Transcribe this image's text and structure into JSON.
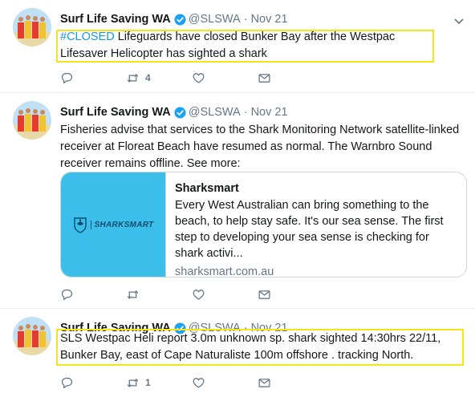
{
  "tweets": [
    {
      "account_name": "Surf Life Saving WA",
      "handle": "@SLSWA",
      "separator": "·",
      "date": "Nov 21",
      "hashtag": "#CLOSED",
      "text": " Lifeguards have closed Bunker Bay after the Westpac Lifesaver Helicopter has sighted a shark",
      "retweet_count": "4",
      "like_count": "",
      "reply_count": ""
    },
    {
      "account_name": "Surf Life Saving WA",
      "handle": "@SLSWA",
      "separator": "·",
      "date": "Nov 21",
      "text": "Fisheries advise that services to the Shark Monitoring Network satellite-linked receiver at Floreat Beach have resumed as normal. The Warnbro Sound receiver remains offline. See more:",
      "retweet_count": "",
      "like_count": "",
      "reply_count": "",
      "card": {
        "logo_text": "SHARKSMART",
        "title": "Sharksmart",
        "description": "Every West Australian can bring something to the beach, to help stay safe. It's our sea sense. The first step to developing your sea sense is checking for shark activi...",
        "domain": "sharksmart.com.au"
      }
    },
    {
      "account_name": "Surf Life Saving WA",
      "handle": "@SLSWA",
      "separator": "·",
      "date": "Nov 21",
      "text": "SLS Westpac Heli report 3.0m unknown sp. shark sighted 14:30hrs 22/11, Bunker Bay, east of Cape Naturaliste 100m offshore . tracking North.",
      "retweet_count": "1",
      "like_count": "",
      "reply_count": ""
    }
  ],
  "icons": {
    "verified": "verified-badge-icon",
    "caret": "chevron-down-icon",
    "reply": "reply-icon",
    "retweet": "retweet-icon",
    "like": "heart-icon",
    "message": "envelope-icon"
  },
  "colors": {
    "highlight": "#f2e51a",
    "link": "#1b95e0",
    "muted": "#657786",
    "verified": "#1da1f2",
    "card_image_bg": "#3bbfea"
  }
}
